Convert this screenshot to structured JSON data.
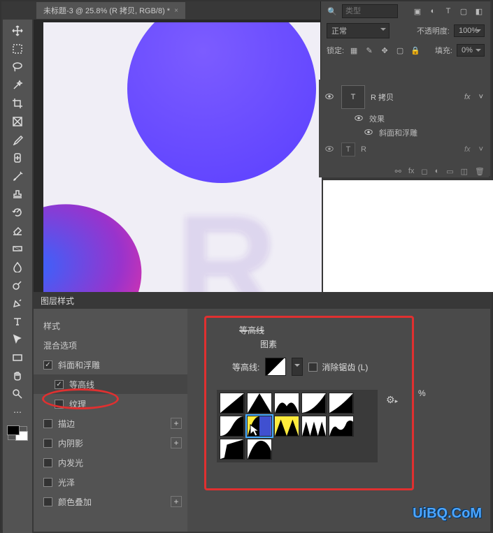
{
  "tab": {
    "title": "未标题-3 @ 25.8% (R 拷贝, RGB/8) *",
    "close": "×"
  },
  "searchbar": {
    "placeholder": "类型"
  },
  "blend": {
    "mode": "正常",
    "opacity_label": "不透明度:",
    "opacity": "100%"
  },
  "lock": {
    "label": "锁定:",
    "fill_label": "填充:",
    "fill": "0%"
  },
  "layers": {
    "l1": {
      "name": "R 拷贝",
      "fx": "fx"
    },
    "sub1": "效果",
    "sub2": "斜面和浮雕",
    "l2": {
      "name": "R",
      "fx": "fx"
    },
    "icons": "⊕ fx ◻ ◐ ▭ ◫ 🗑"
  },
  "ls": {
    "title": "图层样式",
    "items": {
      "style": "样式",
      "blend": "混合选项",
      "bevel": "斜面和浮雕",
      "contour": "等高线",
      "texture": "纹理",
      "stroke": "描边",
      "innershadow": "内阴影",
      "innerglow": "内发光",
      "satin": "光泽",
      "coloroverlay": "颜色叠加"
    }
  },
  "contour": {
    "toplabel": "等高线",
    "section": "图素",
    "label": "等高线:",
    "anti": "消除锯齿 (L)",
    "pct": "%"
  },
  "watermark": "UiBQ.CoM"
}
